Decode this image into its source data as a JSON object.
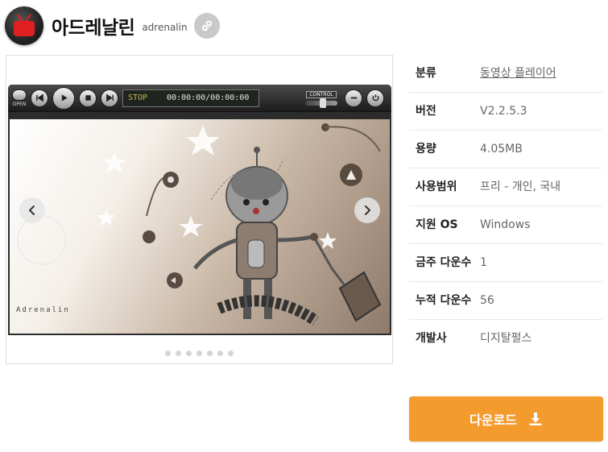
{
  "header": {
    "title": "아드레날린",
    "subtitle": "adrenalin"
  },
  "player": {
    "open_label": "OPEN",
    "status": "STOP",
    "time": "00:00:00/00:00:00",
    "control_label": "CONTROL",
    "watermark": "Adrenalin"
  },
  "gallery": {
    "slide_count": 7,
    "active_slide": 0
  },
  "info": [
    {
      "key": "분류",
      "value": "동영상 플레이어"
    },
    {
      "key": "버전",
      "value": "V2.2.5.3"
    },
    {
      "key": "용량",
      "value": "4.05MB"
    },
    {
      "key": "사용범위",
      "value": "프리 - 개인, 국내"
    },
    {
      "key": "지원 OS",
      "value": "Windows"
    },
    {
      "key": "금주 다운수",
      "value": "1"
    },
    {
      "key": "누적 다운수",
      "value": "56"
    },
    {
      "key": "개발사",
      "value": "디지탈펄스"
    }
  ],
  "download": {
    "label": "다운로드"
  },
  "colors": {
    "accent": "#f49b2e",
    "app_icon_red": "#e02020",
    "link_button_bg": "#c9c9c9"
  },
  "icons": [
    "app-logo-icon",
    "link-icon",
    "chevron-left-icon",
    "chevron-right-icon",
    "download-icon"
  ]
}
